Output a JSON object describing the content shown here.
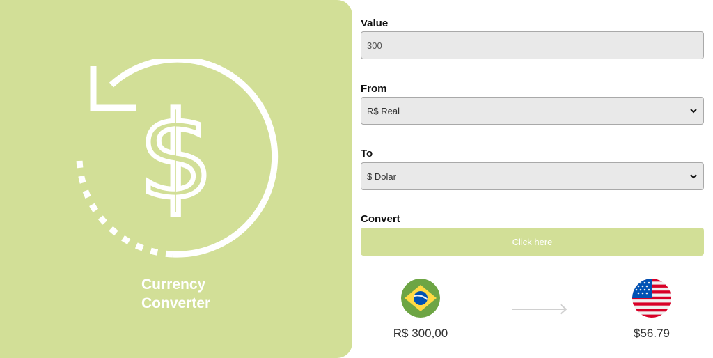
{
  "hero": {
    "title_line1": "Currency",
    "title_line2": "Converter",
    "background_color": "#d2df97",
    "icon": "currency-exchange-icon"
  },
  "form": {
    "value_label": "Value",
    "value_placeholder": "300",
    "from_label": "From",
    "from_selected": "R$ Real",
    "to_label": "To",
    "to_selected": "$ Dolar",
    "convert_label": "Convert",
    "convert_button": "Click here"
  },
  "result": {
    "from_flag": "brazil-flag-icon",
    "from_amount": "R$ 300,00",
    "to_flag": "usa-flag-icon",
    "to_amount": "$56.79"
  },
  "colors": {
    "accent": "#d2df97",
    "input_bg": "#e9e9e9"
  }
}
